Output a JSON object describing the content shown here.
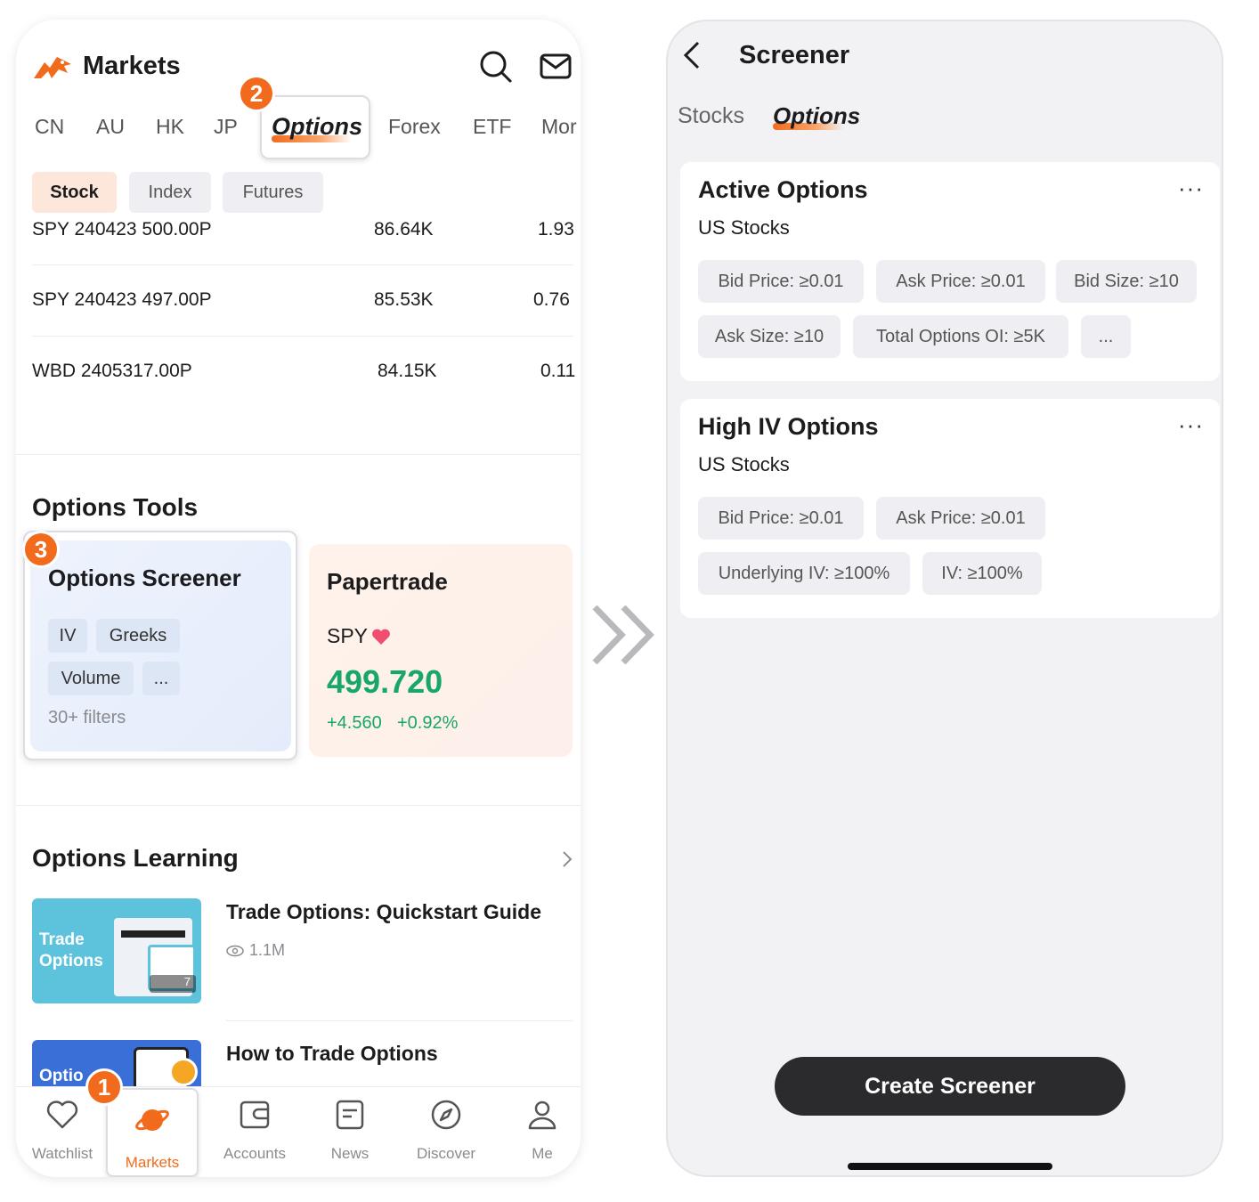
{
  "left": {
    "app_title": "Markets",
    "market_tabs": [
      "CN",
      "AU",
      "HK",
      "JP",
      "Options",
      "Forex",
      "ETF",
      "Mor"
    ],
    "active_market_tab": "Options",
    "step_badges": [
      "1",
      "2",
      "3"
    ],
    "sub_chips": [
      "Stock",
      "Index",
      "Futures"
    ],
    "active_sub_chip": "Stock",
    "option_rows": [
      {
        "symbol": "SPY 240423 500.00P",
        "volume": "86.64K",
        "price": "1.93"
      },
      {
        "symbol": "SPY 240423 497.00P",
        "volume": "85.53K",
        "price": "0.76"
      },
      {
        "symbol": "WBD 2405317.00P",
        "volume": "84.15K",
        "price": "0.11"
      }
    ],
    "tools": {
      "section_title": "Options Tools",
      "screener": {
        "title": "Options Screener",
        "tags": [
          "IV",
          "Greeks",
          "Volume",
          "..."
        ],
        "filters_note": "30+ filters"
      },
      "papertrade": {
        "title": "Papertrade",
        "symbol": "SPY",
        "price": "499.720",
        "change": "+4.560",
        "change_pct": "+0.92%"
      }
    },
    "learning": {
      "section_title": "Options Learning",
      "items": [
        {
          "title": "Trade Options: Quickstart Guide",
          "views": "1.1M",
          "thumb_text_1": "Trade",
          "thumb_text_2": "Options",
          "thumb_badge": "7"
        },
        {
          "title": "How to Trade Options",
          "thumb_text_1": "Optio"
        }
      ]
    },
    "bottom_nav": [
      "Watchlist",
      "Markets",
      "Accounts",
      "News",
      "Discover",
      "Me"
    ],
    "active_nav": "Markets"
  },
  "right": {
    "title": "Screener",
    "tabs": [
      "Stocks",
      "Options"
    ],
    "active_tab": "Options",
    "cards": [
      {
        "title": "Active Options",
        "subtitle": "US Stocks",
        "more": "···",
        "filters": [
          "Bid Price: ≥0.01",
          "Ask Price: ≥0.01",
          "Bid Size: ≥10",
          "Ask Size: ≥10",
          "Total Options OI: ≥5K",
          "..."
        ]
      },
      {
        "title": "High IV Options",
        "subtitle": "US Stocks",
        "more": "···",
        "filters": [
          "Bid Price: ≥0.01",
          "Ask Price: ≥0.01",
          "Underlying IV: ≥100%",
          "IV: ≥100%"
        ]
      }
    ],
    "create_button": "Create Screener"
  },
  "colors": {
    "accent_orange": "#f26b1d",
    "positive_green": "#17a66b",
    "heart_pink": "#f04e6e",
    "dark_button": "#2b2b2d"
  }
}
